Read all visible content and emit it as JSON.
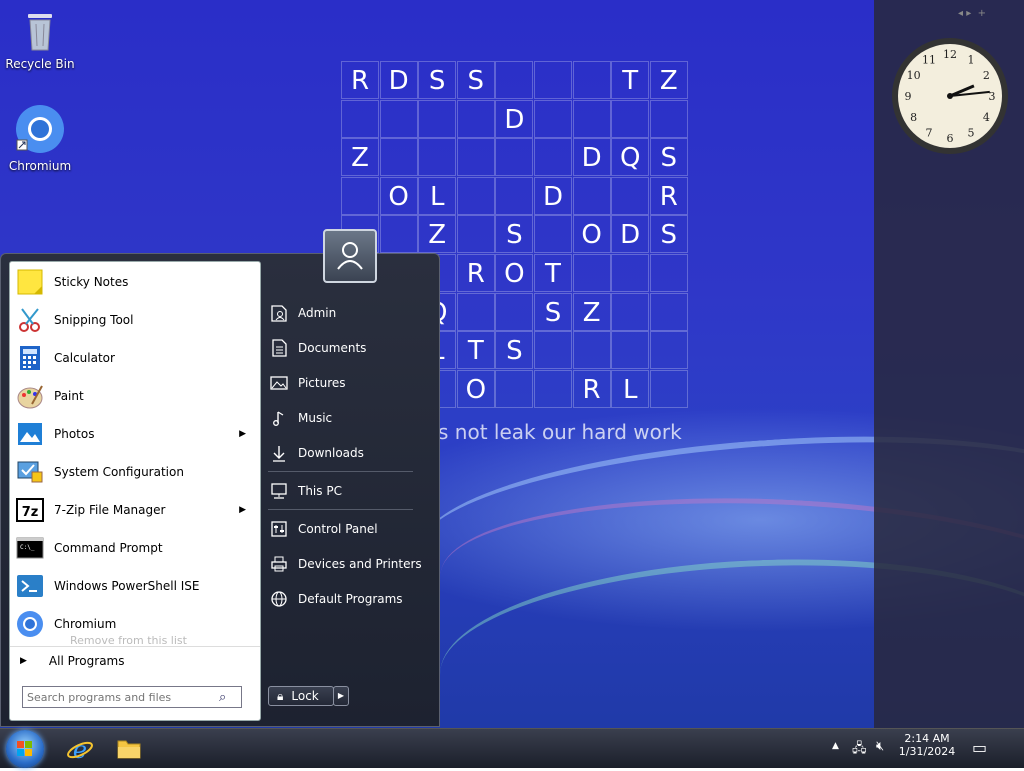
{
  "desktop": {
    "icons": [
      {
        "label": "Recycle Bin",
        "icon": "recycle-bin-icon"
      },
      {
        "label": "Chromium",
        "icon": "chromium-icon"
      }
    ],
    "puzzle_rows": [
      [
        "R",
        "D",
        "S",
        "S",
        "",
        "",
        "",
        "T",
        "Z"
      ],
      [
        "",
        "",
        "",
        "",
        "D",
        "",
        "",
        "",
        ""
      ],
      [
        "Z",
        "",
        "",
        "",
        "",
        "",
        "D",
        "Q",
        "S"
      ],
      [
        "",
        "O",
        "L",
        "",
        "",
        "D",
        "",
        "",
        "R"
      ],
      [
        "",
        "",
        "Z",
        "",
        "S",
        "",
        "O",
        "D",
        "S"
      ],
      [
        "",
        "",
        "",
        "R",
        "O",
        "T",
        "",
        "",
        ""
      ],
      [
        "",
        "",
        "Q",
        "",
        "",
        "S",
        "Z",
        "",
        ""
      ],
      [
        "",
        "",
        "L",
        "T",
        "S",
        "",
        "",
        "",
        ""
      ],
      [
        "",
        "",
        "",
        "O",
        "",
        "",
        "R",
        "L",
        ""
      ]
    ],
    "watermark": "s not leak our hard work"
  },
  "clock": {
    "hour": 2,
    "minute": 14
  },
  "start_menu": {
    "programs": [
      {
        "label": "Sticky Notes",
        "icon": "sticky-notes-icon",
        "has_arrow": false
      },
      {
        "label": "Snipping Tool",
        "icon": "snipping-tool-icon",
        "has_arrow": false
      },
      {
        "label": "Calculator",
        "icon": "calculator-icon",
        "has_arrow": false
      },
      {
        "label": "Paint",
        "icon": "paint-icon",
        "has_arrow": false
      },
      {
        "label": "Photos",
        "icon": "photos-icon",
        "has_arrow": true
      },
      {
        "label": "System Configuration",
        "icon": "system-configuration-icon",
        "has_arrow": false
      },
      {
        "label": "7-Zip File Manager",
        "icon": "7zip-icon",
        "has_arrow": true
      },
      {
        "label": "Command Prompt",
        "icon": "command-prompt-icon",
        "has_arrow": false
      },
      {
        "label": "Windows PowerShell ISE",
        "icon": "powershell-icon",
        "has_arrow": false
      },
      {
        "label": "Chromium",
        "icon": "chromium-icon",
        "has_arrow": false
      }
    ],
    "tooltip": "Remove from this list",
    "all_programs": "All Programs",
    "search_placeholder": "Search programs and files",
    "places": [
      {
        "label": "Admin",
        "icon": "user-folder-icon"
      },
      {
        "label": "Documents",
        "icon": "document-icon"
      },
      {
        "label": "Pictures",
        "icon": "pictures-icon"
      },
      {
        "label": "Music",
        "icon": "music-icon"
      },
      {
        "label": "Downloads",
        "icon": "download-icon"
      },
      {
        "label": "This PC",
        "icon": "computer-icon"
      },
      {
        "label": "Control Panel",
        "icon": "control-panel-icon"
      },
      {
        "label": "Devices and Printers",
        "icon": "printer-icon"
      },
      {
        "label": "Default Programs",
        "icon": "globe-icon"
      }
    ],
    "lock_label": "Lock"
  },
  "taskbar": {
    "time": "2:14 AM",
    "date": "1/31/2024",
    "pinned": [
      "internet-explorer-icon",
      "file-explorer-icon"
    ]
  }
}
